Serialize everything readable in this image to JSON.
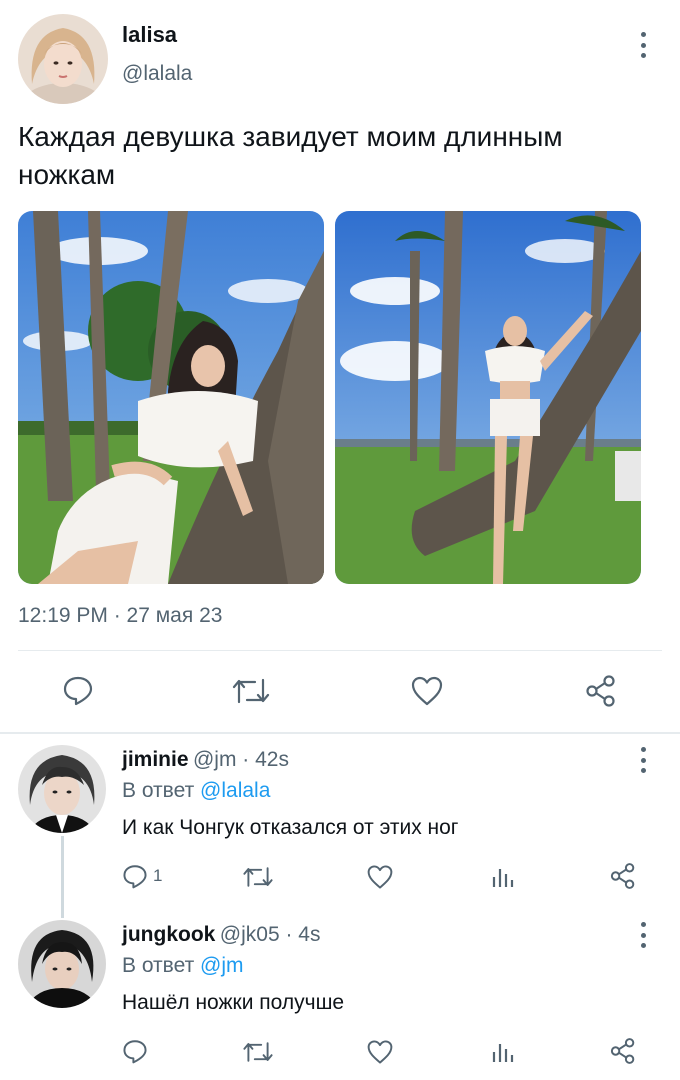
{
  "main_tweet": {
    "display_name": "lalisa",
    "handle": "@lalala",
    "text": "Каждая девушка завидует моим длинным ножкам",
    "timestamp": "12:19 PM · 27 мая 23",
    "icons": [
      "comment-icon",
      "retweet-icon",
      "like-icon",
      "share-icon",
      "more-icon"
    ]
  },
  "replies": [
    {
      "display_name": "jiminie",
      "meta": "@jm · 42s",
      "reply_prefix": "В ответ",
      "reply_to": "@lalala",
      "text": "И как Чонгук отказался от этих ног",
      "reply_count": "1"
    },
    {
      "display_name": "jungkook",
      "meta": "@jk05 · 4s",
      "reply_prefix": "В ответ",
      "reply_to": "@jm",
      "text": "Нашёл ножки получше",
      "reply_count": ""
    }
  ],
  "colors": {
    "text": "#0f1419",
    "secondary": "#536471",
    "link": "#1d9bf0",
    "divider": "#e6ebee"
  }
}
